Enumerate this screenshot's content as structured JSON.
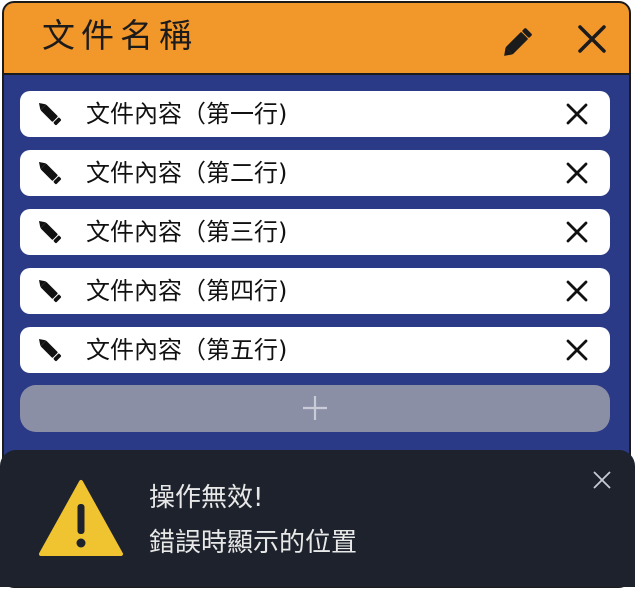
{
  "window": {
    "title": "文件名稱",
    "title_edit_icon": "pencil-icon",
    "title_close_icon": "close-icon"
  },
  "rows": [
    {
      "text": "文件內容（第一行)",
      "edit_icon": "pencil-icon",
      "close_icon": "close-icon"
    },
    {
      "text": "文件內容（第二行)",
      "edit_icon": "pencil-icon",
      "close_icon": "close-icon"
    },
    {
      "text": "文件內容（第三行)",
      "edit_icon": "pencil-icon",
      "close_icon": "close-icon"
    },
    {
      "text": "文件內容（第四行)",
      "edit_icon": "pencil-icon",
      "close_icon": "close-icon"
    },
    {
      "text": "文件內容（第五行)",
      "edit_icon": "pencil-icon",
      "close_icon": "close-icon"
    }
  ],
  "add_button": {
    "icon": "plus-icon"
  },
  "toast": {
    "icon": "warning-icon",
    "line1": "操作無效!",
    "line2": "錯誤時顯示的位置",
    "close_icon": "close-icon"
  },
  "colors": {
    "titlebar": "#f2972a",
    "panel": "#2b3a86",
    "row": "#ffffff",
    "add_button": "#8b8fa6",
    "toast": "#1d222c",
    "warning": "#f0c330"
  }
}
